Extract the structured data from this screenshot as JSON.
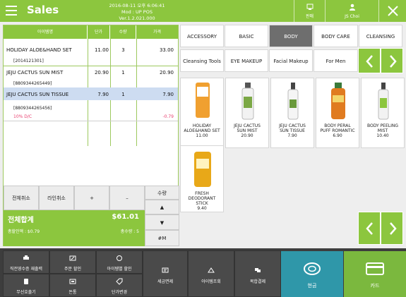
{
  "header": {
    "title": "Sales",
    "date": "2016-08-11 오후 6:06:41",
    "version": "Mod : UP POS Ver.1.2.021.000",
    "register_label": "판매",
    "user_label": "JS Choi"
  },
  "cart": {
    "columns": [
      "아이템명",
      "단가",
      "수량",
      "가격"
    ],
    "rows": [
      {
        "name": "HOLIDAY ALOE&HAND SET",
        "unit_price": "11.00",
        "qty": "3",
        "price": "33.00",
        "code": "[2014121301]"
      },
      {
        "name": "JEJU CACTUS SUN MIST",
        "unit_price": "20.90",
        "qty": "1",
        "price": "20.90",
        "code": "[8809344265449]"
      },
      {
        "name": "JEJU CACTUS SUN TISSUE",
        "unit_price": "7.90",
        "qty": "1",
        "price": "7.90",
        "code": "[8809344265456]",
        "discount_label": "10% D/C",
        "discount_value": "-0.79"
      }
    ]
  },
  "controls": {
    "cancel_all": "전체취소",
    "cancel_line": "라인취소",
    "plus": "+",
    "minus": "–",
    "qty": "수량",
    "up": "▲",
    "down": "▼",
    "hash_m": "#M"
  },
  "totals": {
    "label": "전체합계",
    "amount": "$61.01",
    "discount_label": "총할인액 : $0.79",
    "qty_label": "총수량 : 5"
  },
  "categories": {
    "row1": [
      "ACCESSORY",
      "BASIC",
      "BODY",
      "BODY CARE",
      "CLEANSING"
    ],
    "row2": [
      "Cleansing Tools",
      "EYE MAKEUP",
      "Facial Makeup",
      "For Men"
    ],
    "active": "BODY"
  },
  "products": [
    {
      "name1": "HOLIDAY",
      "name2": "ALOE&HAND SET",
      "name3": "",
      "price": "11.00",
      "color": "#f0a030"
    },
    {
      "name1": "JEJU CACTUS",
      "name2": "SUN MIST",
      "name3": "",
      "price": "20.90",
      "color": "#f2f2f2"
    },
    {
      "name1": "JEJU CACTUS",
      "name2": "SUN TISSUE",
      "name3": "",
      "price": "7.90",
      "color": "#f5f5f5"
    },
    {
      "name1": "BODY PERAL",
      "name2": "PUFF ROMANTIC",
      "name3": "",
      "price": "6.90",
      "color": "#e07b20"
    },
    {
      "name1": "BODY PEELING",
      "name2": "MIST",
      "name3": "",
      "price": "10.40",
      "color": "#f2f2f2"
    },
    {
      "name1": "FRESH",
      "name2": "DEODORANT",
      "name3": "STICK",
      "price": "9.40",
      "color": "#e8a818"
    }
  ],
  "toolbar": {
    "btn1": "직전영수증 재출력",
    "btn2": "주문 할인",
    "btn3": "아이템별 할인",
    "btn4": "무선호출기",
    "btn5": "돈통",
    "btn6": "단가변경",
    "btn7": "세금면제",
    "btn8": "아이템조회",
    "btn9": "복합결제",
    "cash": "현금",
    "card": "카드"
  }
}
